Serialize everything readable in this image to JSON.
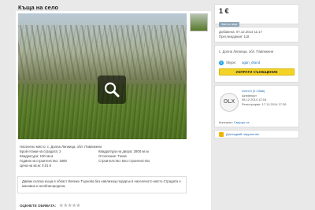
{
  "listing": {
    "title": "Къща на село",
    "price": "1 €",
    "badge": "Частно лице",
    "added": "Добавена: 07.12.2014 11:17",
    "views": "Преглеждания: 118",
    "location": "с. Долна Липница, обл. Павликени",
    "skype_label": "Skype:",
    "skype_name": "agan_drand",
    "message_button": "ИЗПРАТИ СЪОБЩЕНИЕ"
  },
  "seller": {
    "avatar_text": "OLX",
    "name": "neterr3 (0 Обяв)",
    "role": "Активност",
    "last": "08.12.2014 12:18",
    "registered": "Регистриран: 17.11.2014 17:35",
    "contacts_label": "Контакти:",
    "contacts_link": "Свържи се"
  },
  "report": {
    "text": "Докладвай нарушение"
  },
  "details": {
    "rows": [
      [
        "Населено място: с. Долна Липница, обл. Павликени",
        ""
      ],
      [
        "Брой етажи на сградата: 2",
        "Квадратура на двора: 2800 кв.м"
      ],
      [
        "Квадратура: 100 кв.м",
        "Отопление: Токов"
      ],
      [
        "Година на строителство: 1969",
        "Строителство: Без строителство"
      ],
      [
        "Цена на кв.м: 0.01 €",
        ""
      ]
    ]
  },
  "description": "Давам селска къща в област Велико Търново,без навлизащ подарък в населеното място.Сградата е масивна и необлагородена.",
  "rating": {
    "label": "ОЦЕНЕТЕ ОБЯВАТА:"
  },
  "colors": {
    "accent_button": "#f4d327",
    "link": "#2a6fb5",
    "badge": "#8fa6b8"
  }
}
